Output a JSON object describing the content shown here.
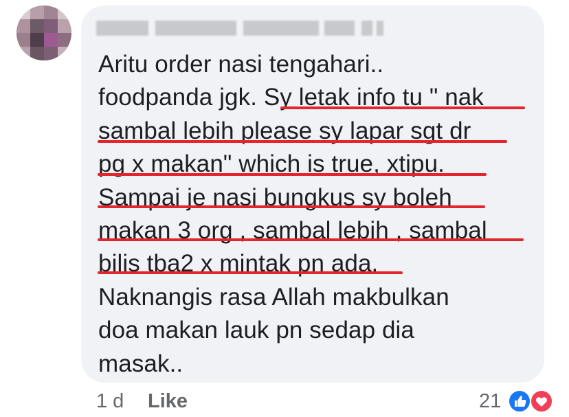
{
  "comment": {
    "author_name": "",
    "lines": [
      "Aritu order nasi tengahari..",
      "foodpanda jgk. Sy letak info tu \" nak",
      "sambal lebih please sy lapar sgt dr",
      "pg x makan\" which is true, xtipu.",
      "Sampai je nasi bungkus sy boleh",
      "makan 3 org , sambal lebih , sambal",
      "bilis tba2 x mintak pn ada.",
      "Naknangis rasa Allah makbulkan",
      "doa makan lauk pn sedap dia",
      "masak.."
    ]
  },
  "footer": {
    "time": "1 d",
    "like_label": "Like",
    "reaction_count": "21"
  },
  "reactions": [
    {
      "icon": "like-reaction-icon",
      "color": "#1877f2"
    },
    {
      "icon": "love-reaction-icon",
      "color": "#f33e58"
    }
  ],
  "colors": {
    "bubble": "#f0f2f5",
    "text": "#1c1e21",
    "secondary": "#65676b",
    "annotation_underline": "#e3252d"
  }
}
